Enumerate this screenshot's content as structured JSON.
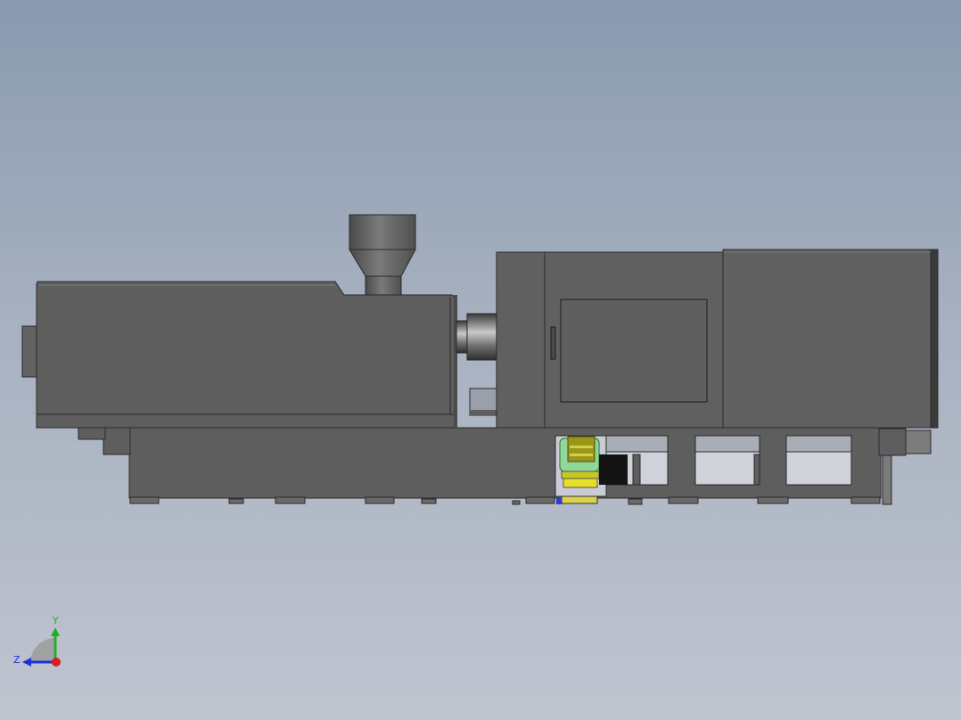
{
  "viewport": {
    "background_top": "#8a9aaf",
    "background_bottom": "#bfc4cf"
  },
  "model": {
    "body_color": "#5e5e5e",
    "edge_color": "#2a2a2a",
    "panel_color": "#606060",
    "hopper_color": "#6c6c6c",
    "motor_green": "#8fd89a",
    "motor_yellow": "#e6e02a"
  },
  "triad": {
    "y_label": "Y",
    "z_label": "Z",
    "y_color": "#1db02d",
    "z_color": "#1a33d6",
    "x_color": "#d81e1e"
  }
}
